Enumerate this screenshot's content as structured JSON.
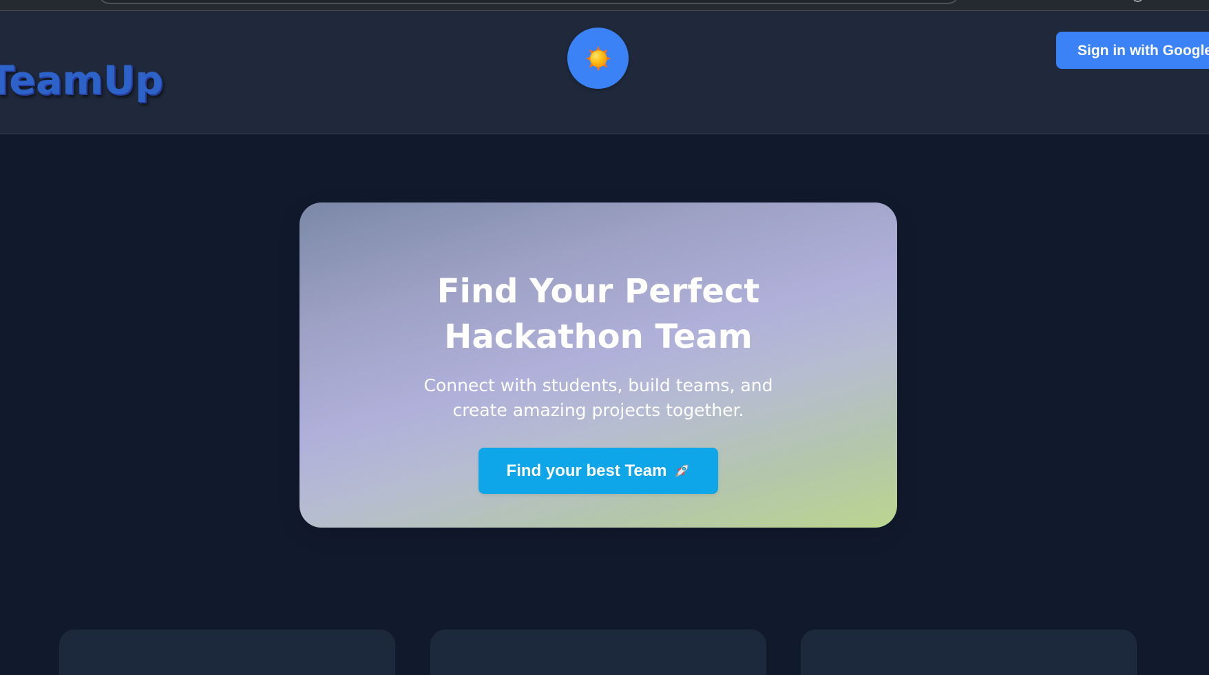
{
  "header": {
    "brand": "TeamUp",
    "theme_toggle_icon": "sun-icon",
    "sign_in_label": "Sign in with Google"
  },
  "hero": {
    "title": "Find Your Perfect Hackathon Team",
    "subtitle": "Connect with students, build teams, and create amazing projects together.",
    "cta_label": "Find your best Team",
    "cta_icon": "rocket-icon"
  },
  "colors": {
    "page_background": "#111a2d",
    "header_background": "#1f293b",
    "brand_text": "#2d62c9",
    "primary_button": "#3b82f6",
    "cta_button": "#0ea5e9",
    "card_background": "#1c283b"
  }
}
